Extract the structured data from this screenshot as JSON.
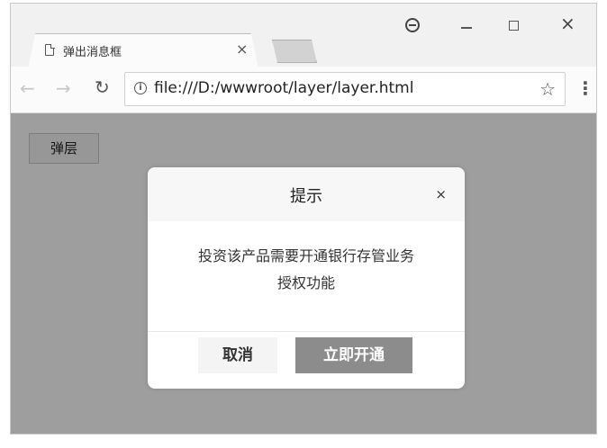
{
  "browser": {
    "tab_title": "弹出消息框",
    "tab_close": "×",
    "url": "file:///D:/wwwroot/layer/layer.html",
    "window_close": "×"
  },
  "page": {
    "open_button_label": "弹层"
  },
  "dialog": {
    "title": "提示",
    "close_label": "×",
    "message_line1": "投资该产品需要开通银行存管业务",
    "message_line2": "授权功能",
    "cancel_label": "取消",
    "confirm_label": "立即开通"
  },
  "colors": {
    "mask": "#a6a6a6",
    "confirm_button": "#8c8c8c"
  }
}
